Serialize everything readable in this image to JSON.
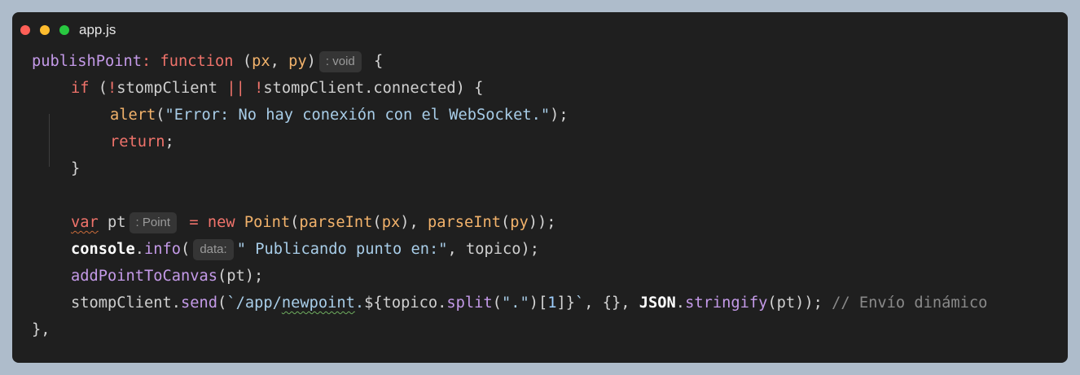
{
  "window": {
    "filename": "app.js",
    "traffic_lights": {
      "close": "#ff5f57",
      "minimize": "#febc2e",
      "maximize": "#28c840"
    }
  },
  "code": {
    "l1": {
      "name": "publishPoint",
      "colon": ":",
      "kw_function": "function",
      "open": " (",
      "p1": "px",
      "comma": ", ",
      "p2": "py",
      "close": ")",
      "hint": ": void",
      "brace": " {"
    },
    "l2": {
      "kw_if": "if",
      "open": " (",
      "not1": "!",
      "id1": "stompClient",
      "or": " || ",
      "not2": "!",
      "id2": "stompClient",
      "dot": ".",
      "prop": "connected",
      "close": ") {"
    },
    "l3": {
      "fn": "alert",
      "open": "(",
      "str": "\"Error: No hay conexión con el WebSocket.\"",
      "close": ");"
    },
    "l4": {
      "kw_return": "return",
      "semi": ";"
    },
    "l5": {
      "brace": "}"
    },
    "l7": {
      "kw_var": "var",
      "sp": " ",
      "id": "pt",
      "hint": ": Point",
      "eq": " = ",
      "kw_new": "new",
      "sp2": " ",
      "cls": "Point",
      "open": "(",
      "fn1": "parseInt",
      "o1": "(",
      "a1": "px",
      "c1": "), ",
      "fn2": "parseInt",
      "o2": "(",
      "a2": "py",
      "c2": "));"
    },
    "l8": {
      "obj": "console",
      "dot": ".",
      "method": "info",
      "open": "(",
      "hint": "data:",
      "str": "\" Publicando punto en:\"",
      "mid": ", ",
      "arg": "topico",
      "close": ");"
    },
    "l9": {
      "fn": "addPointToCanvas",
      "open": "(",
      "arg": "pt",
      "close": ");"
    },
    "l10": {
      "obj": "stompClient",
      "dot": ".",
      "method": "send",
      "open": "(",
      "tpl1": "`/app/",
      "tpl2": "newpoint",
      "tpl3": ".",
      "interp_open": "${",
      "id": "topico",
      "dot2": ".",
      "split": "split",
      "so": "(",
      "sarg": "\".\"",
      "sc": ")[",
      "idx": "1",
      "ic": "]}",
      "tpl_end": "`",
      "args": ", {}, ",
      "json": "JSON",
      "dot3": ".",
      "stringify": "stringify",
      "st_o": "(",
      "st_arg": "pt",
      "st_c": "));",
      "comment": " // Envío dinámico"
    },
    "l11": {
      "end": "},"
    }
  }
}
